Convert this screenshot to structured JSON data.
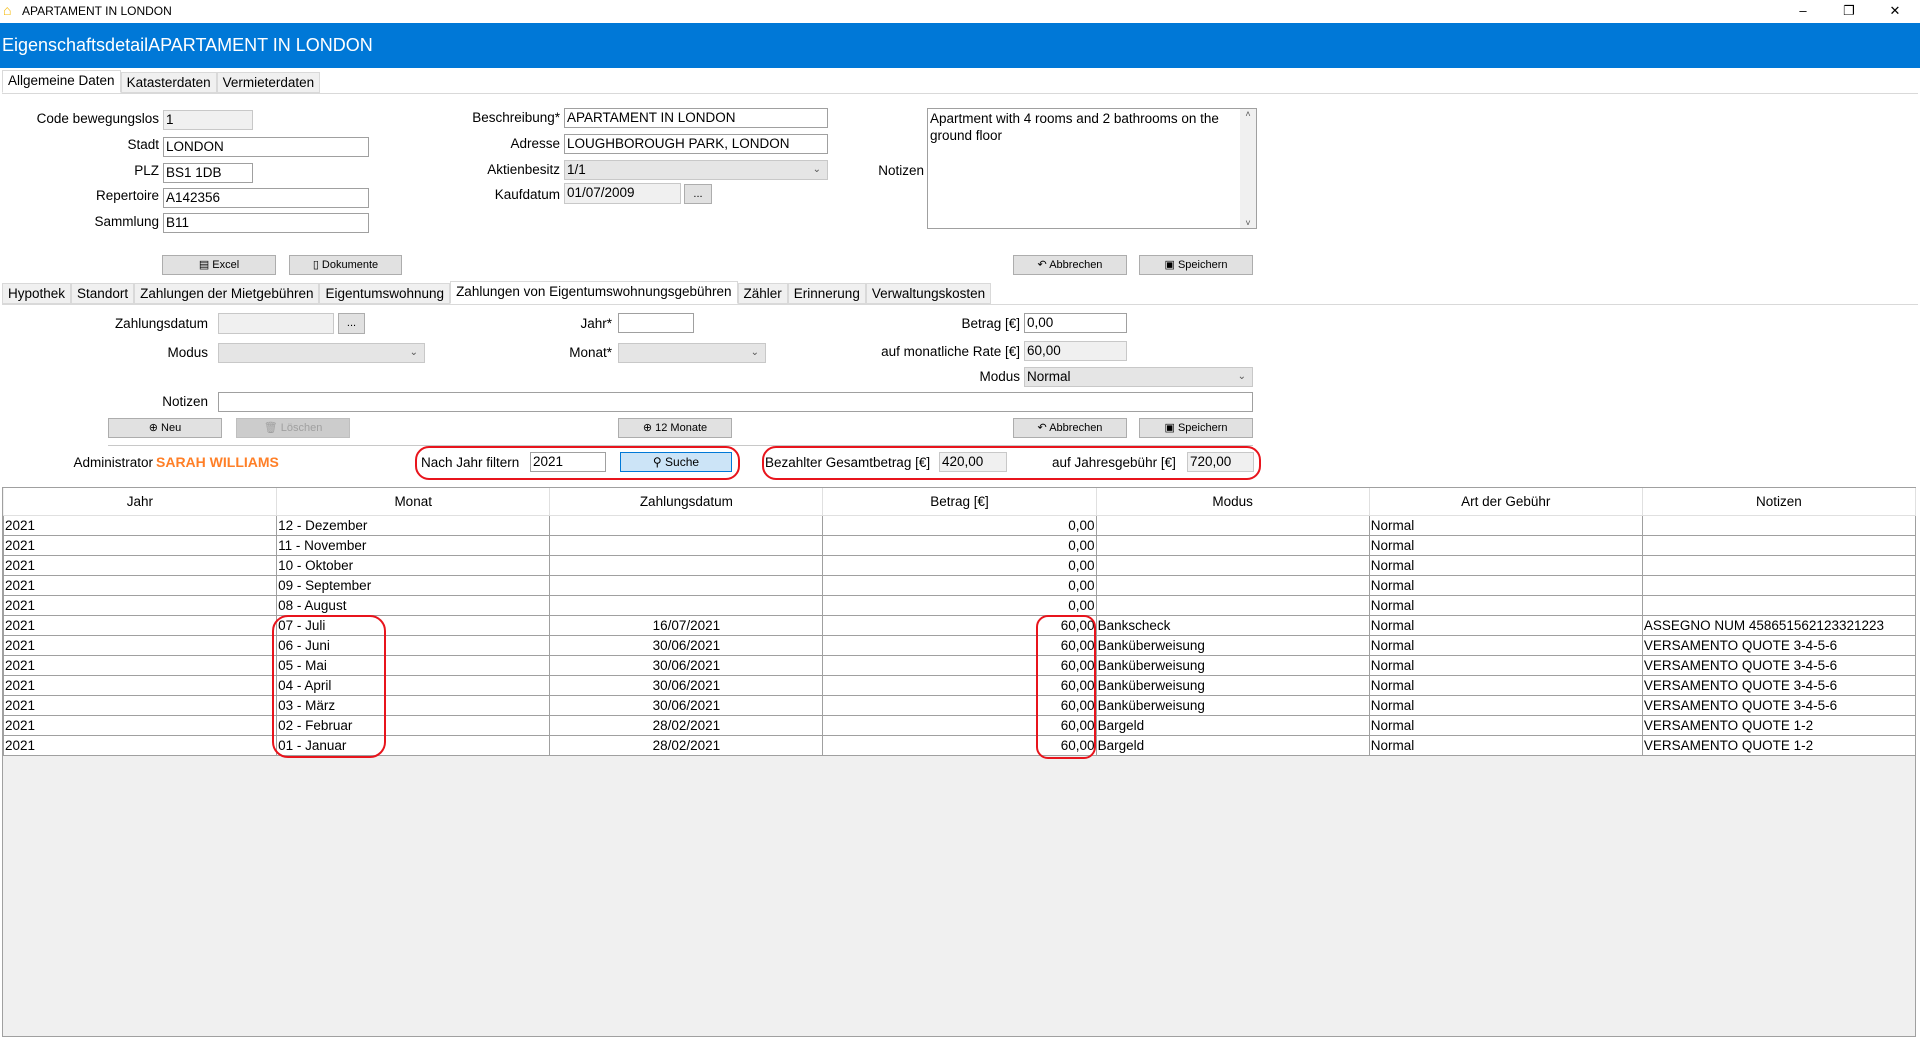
{
  "window": {
    "title": "APARTAMENT IN LONDON",
    "minimize": "–",
    "restore": "❐",
    "close": "✕"
  },
  "header": {
    "title": "EigenschaftsdetailAPARTAMENT IN LONDON"
  },
  "top_tabs": [
    "Allgemeine Daten",
    "Katasterdaten",
    "Vermieterdaten"
  ],
  "general": {
    "code_label": "Code bewegungslos",
    "code": "1",
    "stadt_label": "Stadt",
    "stadt": "LONDON",
    "plz_label": "PLZ",
    "plz": "BS1 1DB",
    "repertoire_label": "Repertoire",
    "repertoire": "A142356",
    "sammlung_label": "Sammlung",
    "sammlung": "B11",
    "beschreibung_label": "Beschreibung*",
    "beschreibung": "APARTAMENT IN LONDON",
    "adresse_label": "Adresse",
    "adresse": "LOUGHBOROUGH PARK, LONDON",
    "aktien_label": "Aktienbesitz",
    "aktien": "1/1",
    "kaufdatum_label": "Kaufdatum",
    "kaufdatum": "01/07/2009",
    "picker": "...",
    "notizen_label": "Notizen",
    "notizen": "Apartment with 4 rooms and 2 bathrooms on the ground floor",
    "excel": "Excel",
    "dokumente": "Dokumente",
    "abbrechen": "Abbrechen",
    "speichern": "Speichern"
  },
  "sub_tabs": [
    "Hypothek",
    "Standort",
    "Zahlungen der Mietgebühren",
    "Eigentumswohnung",
    "Zahlungen von Eigentumswohnungsgebühren",
    "Zähler",
    "Erinnerung",
    "Verwaltungskosten"
  ],
  "payment_form": {
    "zahlungsdatum_label": "Zahlungsdatum",
    "zahlungsdatum": "",
    "picker": "...",
    "modus_label": "Modus",
    "modus": "",
    "jahr_label": "Jahr*",
    "jahr": "",
    "monat_label": "Monat*",
    "monat": "",
    "betrag_label": "Betrag [€]",
    "betrag": "0,00",
    "rate_label": "auf monatliche Rate [€]",
    "rate": "60,00",
    "modus2_label": "Modus",
    "modus2": "Normal",
    "notizen_label": "Notizen",
    "notizen": "",
    "neu": "Neu",
    "loeschen": "Löschen",
    "zwoelf_monate": "12 Monate",
    "abbrechen": "Abbrechen",
    "speichern": "Speichern"
  },
  "summary": {
    "admin_label": "Administrator",
    "admin_name": "SARAH WILLIAMS",
    "admin_color": "#ff7f27",
    "filter_label": "Nach Jahr filtern",
    "filter_year": "2021",
    "search": "Suche",
    "paid_label": "Bezahlter Gesamtbetrag [€]",
    "paid": "420,00",
    "annual_label": "auf Jahresgebühr [€]",
    "annual": "720,00"
  },
  "table": {
    "columns": [
      "Jahr",
      "Monat",
      "Zahlungsdatum",
      "Betrag [€]",
      "Modus",
      "Art der Gebühr",
      "Notizen"
    ],
    "rows": [
      [
        "2021",
        "12 - Dezember",
        "",
        "0,00",
        "",
        "Normal",
        ""
      ],
      [
        "2021",
        "11 - November",
        "",
        "0,00",
        "",
        "Normal",
        ""
      ],
      [
        "2021",
        "10 - Oktober",
        "",
        "0,00",
        "",
        "Normal",
        ""
      ],
      [
        "2021",
        "09 - September",
        "",
        "0,00",
        "",
        "Normal",
        ""
      ],
      [
        "2021",
        "08 - August",
        "",
        "0,00",
        "",
        "Normal",
        ""
      ],
      [
        "2021",
        "07 - Juli",
        "16/07/2021",
        "60,00",
        "Bankscheck",
        "Normal",
        "ASSEGNO NUM 458651562123321223"
      ],
      [
        "2021",
        "06 - Juni",
        "30/06/2021",
        "60,00",
        "Banküberweisung",
        "Normal",
        "VERSAMENTO QUOTE 3-4-5-6"
      ],
      [
        "2021",
        "05 - Mai",
        "30/06/2021",
        "60,00",
        "Banküberweisung",
        "Normal",
        "VERSAMENTO QUOTE 3-4-5-6"
      ],
      [
        "2021",
        "04 - April",
        "30/06/2021",
        "60,00",
        "Banküberweisung",
        "Normal",
        "VERSAMENTO QUOTE 3-4-5-6"
      ],
      [
        "2021",
        "03 - März",
        "30/06/2021",
        "60,00",
        "Banküberweisung",
        "Normal",
        "VERSAMENTO QUOTE 3-4-5-6"
      ],
      [
        "2021",
        "02 - Februar",
        "28/02/2021",
        "60,00",
        "Bargeld",
        "Normal",
        "VERSAMENTO QUOTE 1-2"
      ],
      [
        "2021",
        "01 - Januar",
        "28/02/2021",
        "60,00",
        "Bargeld",
        "Normal",
        "VERSAMENTO QUOTE 1-2"
      ]
    ]
  }
}
